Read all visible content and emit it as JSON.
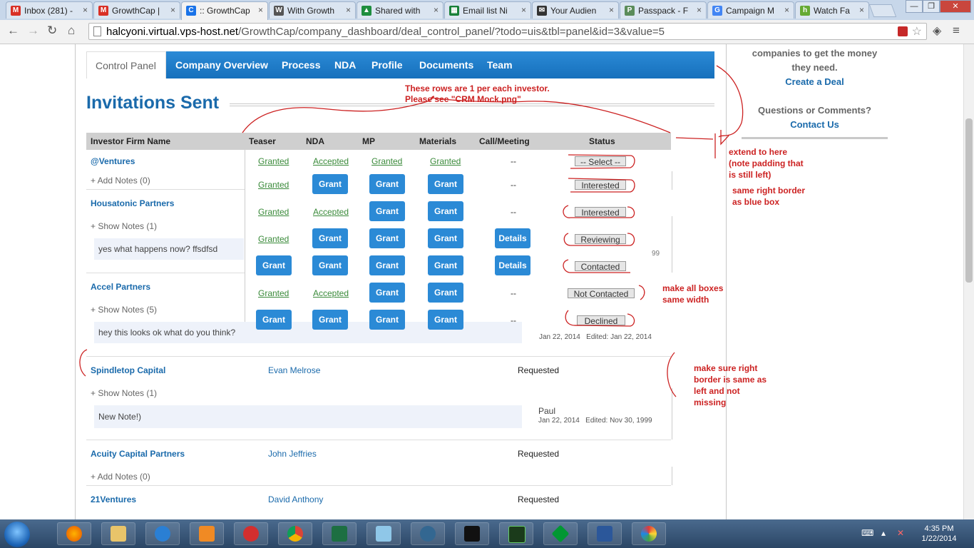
{
  "browser": {
    "tabs": [
      {
        "title": "Inbox (281) -",
        "favicon": "gmail-icon",
        "color": "#d93025",
        "letter": "M"
      },
      {
        "title": "GrowthCap |",
        "favicon": "gmail-icon",
        "color": "#d93025",
        "letter": "M"
      },
      {
        "title": ":: GrowthCap",
        "favicon": "growthcap-icon",
        "color": "#1a73e8",
        "letter": "C",
        "active": true
      },
      {
        "title": "With Growth",
        "favicon": "doc-icon",
        "color": "#555555",
        "letter": "W"
      },
      {
        "title": "Shared with",
        "favicon": "drive-icon",
        "color": "#1e8e3e",
        "letter": "▲"
      },
      {
        "title": "Email list Ni",
        "favicon": "sheets-icon",
        "color": "#188038",
        "letter": "▦"
      },
      {
        "title": "Your Audien",
        "favicon": "mailchimp-icon",
        "color": "#333333",
        "letter": "✉"
      },
      {
        "title": "Passpack - F",
        "favicon": "passpack-icon",
        "color": "#5b8c5a",
        "letter": "P"
      },
      {
        "title": "Campaign M",
        "favicon": "google-icon",
        "color": "#4285f4",
        "letter": "G"
      },
      {
        "title": "Watch Fa",
        "favicon": "hulu-icon",
        "color": "#66aa33",
        "letter": "h"
      }
    ],
    "url_host": "halcyoni.virtual.vps-host.net",
    "url_path": "/GrowthCap/company_dashboard/deal_control_panel/?todo=uis&tbl=panel&id=3&value=5"
  },
  "nav": {
    "items": [
      "Control Panel",
      "Company Overview",
      "Process",
      "NDA",
      "Profile",
      "Documents",
      "Team"
    ]
  },
  "page_title": "Invitations Sent",
  "sidebar": {
    "line1": "companies to get the money",
    "line2": "they need.",
    "create_deal": "Create a Deal",
    "questions": "Questions or Comments?",
    "contact_us": "Contact Us"
  },
  "table": {
    "headers": {
      "firm": "Investor Firm Name",
      "teaser": "Teaser",
      "nda": "NDA",
      "mp": "MP",
      "materials": "Materials",
      "call": "Call/Meeting",
      "status": "Status"
    },
    "firms": [
      {
        "name": "@Ventures",
        "notes": "+ Add Notes (0)"
      },
      {
        "name": "Housatonic Partners",
        "notes": "+ Show Notes (1)",
        "note_text": "yes what happens now? ffsdfsd"
      },
      {
        "name": "Accel Partners",
        "notes": "+ Show Notes (5)",
        "note_text": "hey this looks ok what do you think?"
      },
      {
        "name": "Spindletop Capital",
        "notes": "+ Show Notes (1)",
        "note_text": "New Note!)",
        "contact": "Evan Melrose",
        "state": "Requested"
      },
      {
        "name": "Acuity Capital Partners",
        "notes": "+ Add Notes (0)",
        "contact": "John Jeffries",
        "state": "Requested"
      },
      {
        "name": "21Ventures",
        "contact": "David Anthony",
        "state": "Requested"
      }
    ],
    "rows": [
      {
        "teaser": "Granted",
        "nda": "Accepted",
        "mp": "Granted",
        "materials": "Granted",
        "call": "--",
        "status": "-- Select --"
      },
      {
        "teaser": "Granted",
        "nda": "Grant",
        "mp": "Grant",
        "materials": "Grant",
        "call": "--",
        "status": "Interested"
      },
      {
        "teaser": "Granted",
        "nda": "Accepted",
        "mp": "Grant",
        "materials": "Grant",
        "call": "--",
        "status": "Interested"
      },
      {
        "teaser": "Granted",
        "nda": "Grant",
        "mp": "Grant",
        "materials": "Grant",
        "call": "Details",
        "status": "Reviewing"
      },
      {
        "teaser": "Grant",
        "nda": "Grant",
        "mp": "Grant",
        "materials": "Grant",
        "call": "Details",
        "status": "Contacted"
      },
      {
        "teaser": "Granted",
        "nda": "Accepted",
        "mp": "Grant",
        "materials": "Grant",
        "call": "--",
        "status": "Not Contacted"
      },
      {
        "teaser": "Grant",
        "nda": "Grant",
        "mp": "Grant",
        "materials": "Grant",
        "call": "--",
        "status": "Declined"
      }
    ],
    "meta": {
      "housatonic_fragment": "99",
      "accel_dates": "Jan 22, 2014   Edited: Jan 22, 2014",
      "spindletop_author": "Paul",
      "spindletop_dates": "Jan 22, 2014   Edited: Nov 30, 1999"
    }
  },
  "annotations": {
    "rows_note_1": "These rows are 1 per each investor.",
    "rows_note_2": "Please see \"CRM Mock.png\"",
    "extend_1": "extend to here",
    "extend_2": "(note padding that",
    "extend_3": "is still left)",
    "border_1": "same right border",
    "border_2": "as blue box",
    "width_1": "make all boxes",
    "width_2": "same width",
    "right_1": "make sure right",
    "right_2": "border is same as",
    "right_3": "left and not",
    "right_4": "missing"
  },
  "taskbar": {
    "time": "4:35 PM",
    "date": "1/22/2014"
  },
  "colors": {
    "nav_blue": "#1670bc",
    "title_blue": "#1a6aab",
    "grant_blue": "#2b8ad6",
    "granted_green": "#3a8a3a",
    "annotation_red": "#cc2222"
  }
}
